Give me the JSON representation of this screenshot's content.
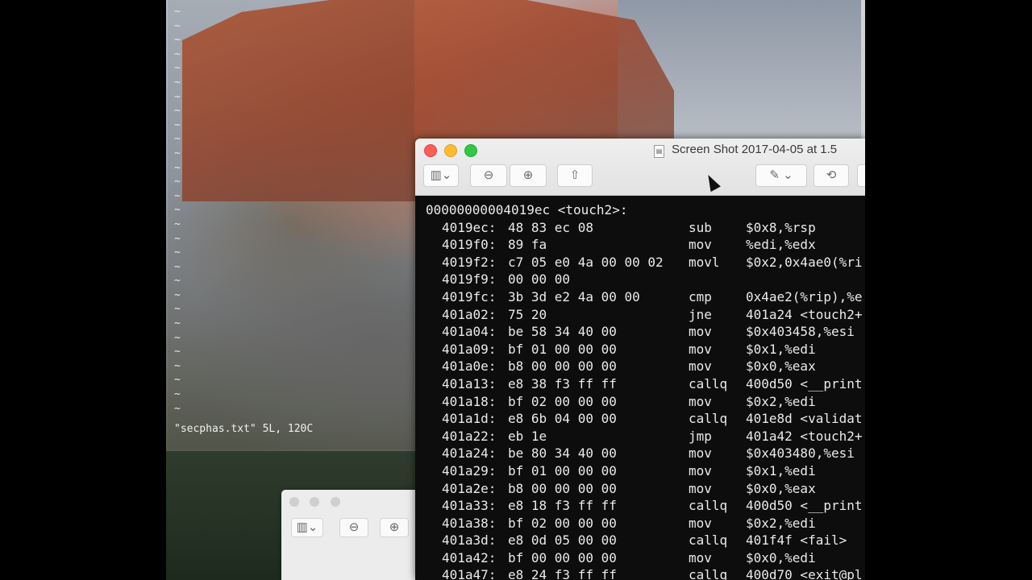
{
  "vim": {
    "tildes": [
      "~",
      "~",
      "~",
      "~",
      "~",
      "~",
      "~",
      "~",
      "~",
      "~",
      "~",
      "~",
      "~",
      "~",
      "~",
      "~",
      "~",
      "~",
      "~",
      "~",
      "~",
      "~",
      "~",
      "~",
      "~",
      "~",
      "~",
      "~",
      "~"
    ],
    "status_line": "\"secphas.txt\" 5L, 120C"
  },
  "preview": {
    "title": "Screen Shot 2017-04-05 at 1.5",
    "toolbar": {
      "sidebar_icon": "sidebar-icon",
      "zoom_out_icon": "zoom-out-icon",
      "zoom_in_icon": "zoom-in-icon",
      "share_icon": "share-icon",
      "markup_icon": "markup-pen-icon",
      "rotate_icon": "rotate-icon"
    }
  },
  "disassembly": {
    "header": "00000000004019ec <touch2>:",
    "lines": [
      {
        "addr": "4019ec:",
        "bytes": "48 83 ec 08",
        "op": "sub",
        "arg": "$0x8,%rsp"
      },
      {
        "addr": "4019f0:",
        "bytes": "89 fa",
        "op": "mov",
        "arg": "%edi,%edx"
      },
      {
        "addr": "4019f2:",
        "bytes": "c7 05 e0 4a 00 00 02",
        "op": "movl",
        "arg": "$0x2,0x4ae0(%ri"
      },
      {
        "addr": "4019f9:",
        "bytes": "00 00 00",
        "op": "",
        "arg": ""
      },
      {
        "addr": "4019fc:",
        "bytes": "3b 3d e2 4a 00 00",
        "op": "cmp",
        "arg": "0x4ae2(%rip),%e"
      },
      {
        "addr": "401a02:",
        "bytes": "75 20",
        "op": "jne",
        "arg": "401a24 <touch2+"
      },
      {
        "addr": "401a04:",
        "bytes": "be 58 34 40 00",
        "op": "mov",
        "arg": "$0x403458,%esi"
      },
      {
        "addr": "401a09:",
        "bytes": "bf 01 00 00 00",
        "op": "mov",
        "arg": "$0x1,%edi"
      },
      {
        "addr": "401a0e:",
        "bytes": "b8 00 00 00 00",
        "op": "mov",
        "arg": "$0x0,%eax"
      },
      {
        "addr": "401a13:",
        "bytes": "e8 38 f3 ff ff",
        "op": "callq",
        "arg": "400d50 <__print"
      },
      {
        "addr": "401a18:",
        "bytes": "bf 02 00 00 00",
        "op": "mov",
        "arg": "$0x2,%edi"
      },
      {
        "addr": "401a1d:",
        "bytes": "e8 6b 04 00 00",
        "op": "callq",
        "arg": "401e8d <validat"
      },
      {
        "addr": "401a22:",
        "bytes": "eb 1e",
        "op": "jmp",
        "arg": "401a42 <touch2+"
      },
      {
        "addr": "401a24:",
        "bytes": "be 80 34 40 00",
        "op": "mov",
        "arg": "$0x403480,%esi"
      },
      {
        "addr": "401a29:",
        "bytes": "bf 01 00 00 00",
        "op": "mov",
        "arg": "$0x1,%edi"
      },
      {
        "addr": "401a2e:",
        "bytes": "b8 00 00 00 00",
        "op": "mov",
        "arg": "$0x0,%eax"
      },
      {
        "addr": "401a33:",
        "bytes": "e8 18 f3 ff ff",
        "op": "callq",
        "arg": "400d50 <__print"
      },
      {
        "addr": "401a38:",
        "bytes": "bf 02 00 00 00",
        "op": "mov",
        "arg": "$0x2,%edi"
      },
      {
        "addr": "401a3d:",
        "bytes": "e8 0d 05 00 00",
        "op": "callq",
        "arg": "401f4f <fail>"
      },
      {
        "addr": "401a42:",
        "bytes": "bf 00 00 00 00",
        "op": "mov",
        "arg": "$0x0,%edi"
      },
      {
        "addr": "401a47:",
        "bytes": "e8 24 f3 ff ff",
        "op": "callq",
        "arg": "400d70 <exit@pl"
      }
    ]
  },
  "colors": {
    "close": "#fc5f57",
    "minimize": "#fdbc2e",
    "zoom": "#33c748",
    "code_bg": "#0d0d0d",
    "code_text": "#eaeaea"
  }
}
